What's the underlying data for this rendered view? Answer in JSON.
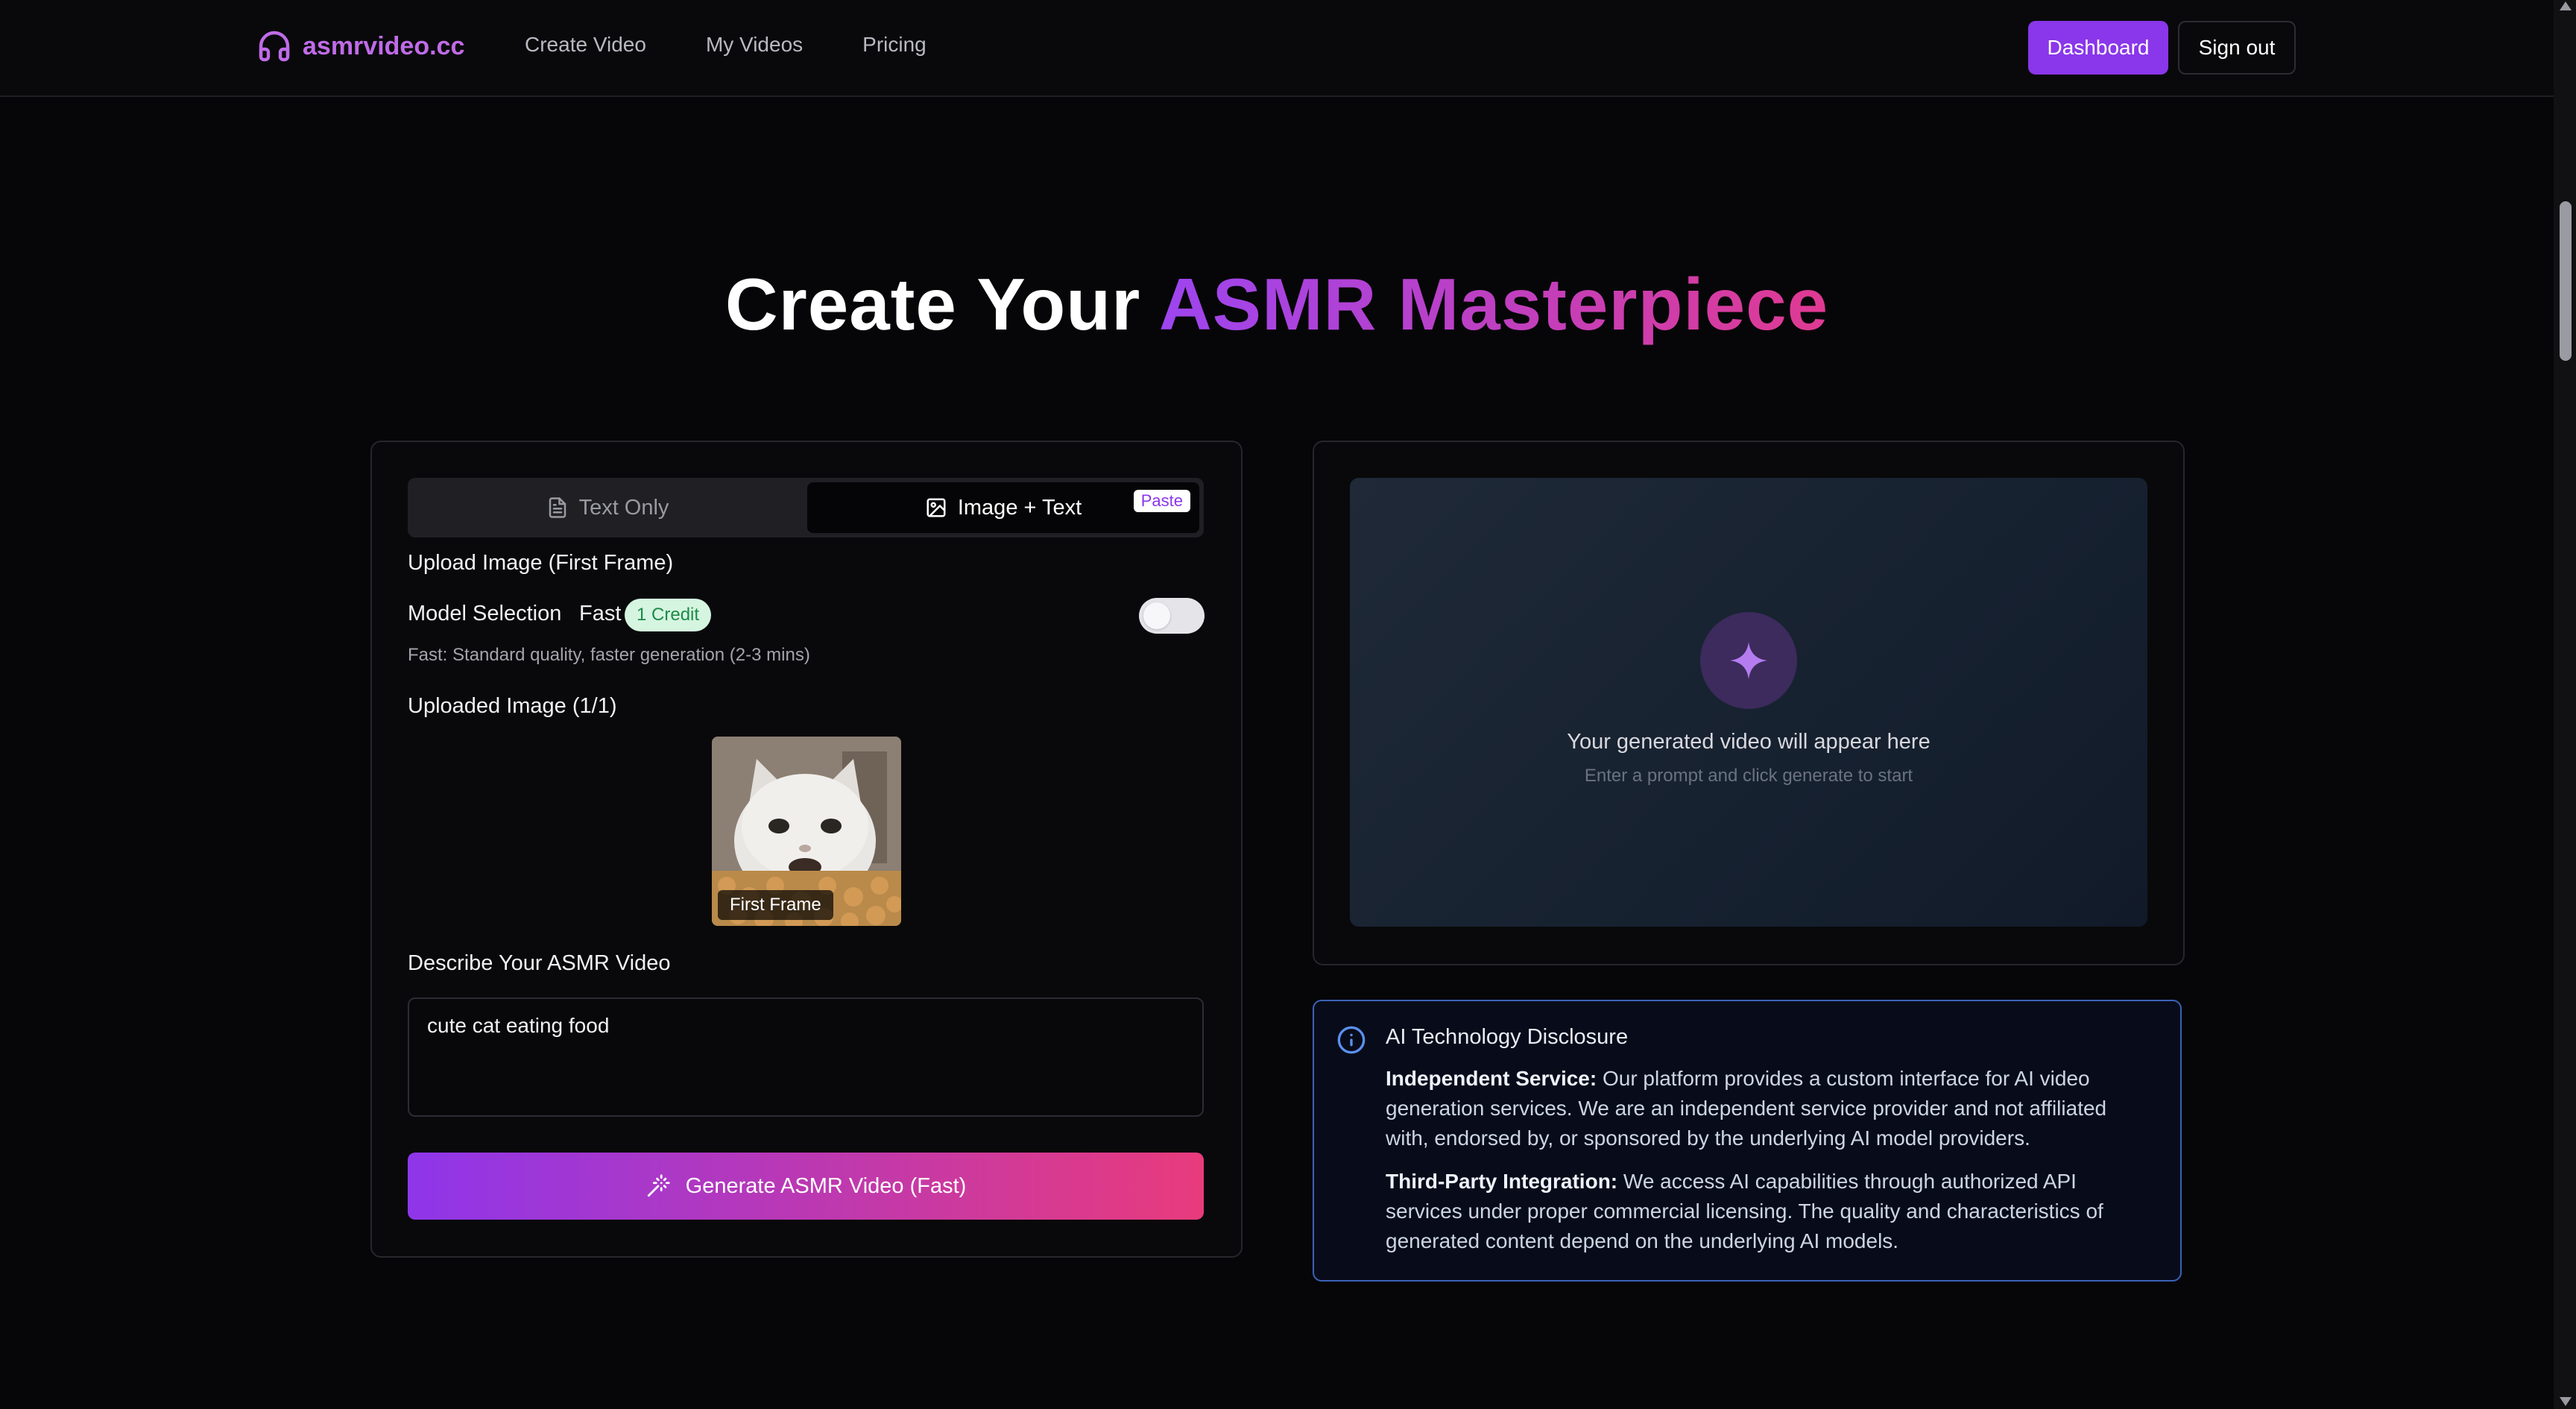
{
  "nav": {
    "logo_text": "asmrvideo.cc",
    "links": [
      "Create Video",
      "My Videos",
      "Pricing"
    ],
    "dashboard_label": "Dashboard",
    "signout_label": "Sign out"
  },
  "hero": {
    "title_white": "Create Your",
    "title_gradient": "ASMR Masterpiece"
  },
  "form": {
    "tabs": [
      {
        "label": "Text Only",
        "icon": "document-icon",
        "active": false
      },
      {
        "label": "Image + Text",
        "icon": "image-icon",
        "active": true
      }
    ],
    "paste_badge": "Paste",
    "upload_label": "Upload Image (First Frame)",
    "model_label": "Model Selection",
    "model_value": "Fast",
    "credit_badge": "1 Credit",
    "model_hint": "Fast: Standard quality, faster generation (2-3 mins)",
    "uploaded_label": "Uploaded Image (1/1)",
    "first_frame_label": "First Frame",
    "describe_label": "Describe Your ASMR Video",
    "prompt_value": "cute cat eating food",
    "generate_label": "Generate ASMR Video (Fast)"
  },
  "preview": {
    "title": "Your generated video will appear here",
    "subtitle": "Enter a prompt and click generate to start"
  },
  "disclosure": {
    "title": "AI Technology Disclosure",
    "p1_bold": "Independent Service:",
    "p1_text": " Our platform provides a custom interface for AI video generation services. We are an independent service provider and not affiliated with, endorsed by, or sponsored by the underlying AI model providers.",
    "p2_bold": "Third-Party Integration:",
    "p2_text": " We access AI capabilities through authorized API services under proper commercial licensing. The quality and characteristics of generated content depend on the underlying AI models."
  },
  "colors": {
    "accent": "#8a36ea",
    "gradient_start": "#9d45f0",
    "gradient_end": "#e03a92",
    "disclosure_border": "#3b62b8"
  }
}
